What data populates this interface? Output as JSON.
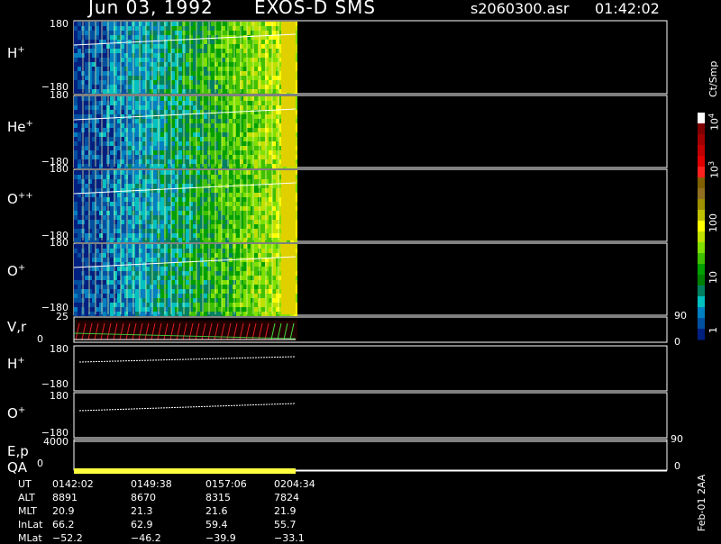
{
  "header": {
    "date": "Jun 03, 1992",
    "instrument": "EXOS-D SMS",
    "file": "s2060300.asr",
    "time": "01:42:02"
  },
  "panels": [
    {
      "label": "H",
      "sup": "+",
      "top": "180",
      "bottom": "−180"
    },
    {
      "label": "He",
      "sup": "+",
      "top": "180",
      "bottom": "−180"
    },
    {
      "label": "O",
      "sup": "++",
      "top": "180",
      "bottom": "−180"
    },
    {
      "label": "O",
      "sup": "+",
      "top": "180",
      "bottom": "−180"
    }
  ],
  "vr": {
    "label": "V,r",
    "top": "25",
    "zero": "0",
    "r_top": "90",
    "r_zero": "0"
  },
  "hplus2": {
    "label": "H",
    "sup": "+",
    "top": "180",
    "bottom": "−180"
  },
  "oplus2": {
    "label": "O",
    "sup": "+",
    "top": "180",
    "bottom": "−180"
  },
  "ep": {
    "label": "E,p",
    "top": "4000",
    "zero": "0",
    "r_top": "90",
    "r_zero": "0"
  },
  "qa": {
    "label": "QA"
  },
  "orbit_table": {
    "rows": [
      {
        "name": "UT",
        "values": [
          "0142:02",
          "0149:38",
          "0157:06",
          "0204:34"
        ]
      },
      {
        "name": "ALT",
        "values": [
          "8891",
          "8670",
          "8315",
          "7824"
        ]
      },
      {
        "name": "MLT",
        "values": [
          "20.9",
          "21.3",
          "21.6",
          "21.9"
        ]
      },
      {
        "name": "InLat",
        "values": [
          "66.2",
          "62.9",
          "59.4",
          "55.7"
        ]
      },
      {
        "name": "MLat",
        "values": [
          "−52.2",
          "−46.2",
          "−39.9",
          "−33.1"
        ]
      }
    ]
  },
  "colorbar": {
    "unit": "Ct/Smp",
    "labels": [
      "10^4",
      "10^3",
      "100",
      "10",
      "1"
    ],
    "colors": [
      "#ffffff",
      "#800000",
      "#a00000",
      "#c00000",
      "#e00000",
      "#ff2020",
      "#806000",
      "#907020",
      "#a09000",
      "#c0c000",
      "#ffff00",
      "#c0e000",
      "#80e000",
      "#40c000",
      "#00a000",
      "#008000",
      "#008060",
      "#00c0c0",
      "#0080c0",
      "#0050a0",
      "#002080"
    ]
  },
  "footer_note": "Feb-01 2AA",
  "chart_data": {
    "type": "heatmap",
    "title": "Jun 03, 1992   EXOS-D SMS",
    "x_ticks": [
      "0142:02",
      "0149:38",
      "0157:06",
      "0204:34"
    ],
    "panels": [
      "H+",
      "He+",
      "O++",
      "O+"
    ],
    "ylim": [
      -180,
      180
    ],
    "colorbar_range": [
      1,
      10000
    ]
  }
}
